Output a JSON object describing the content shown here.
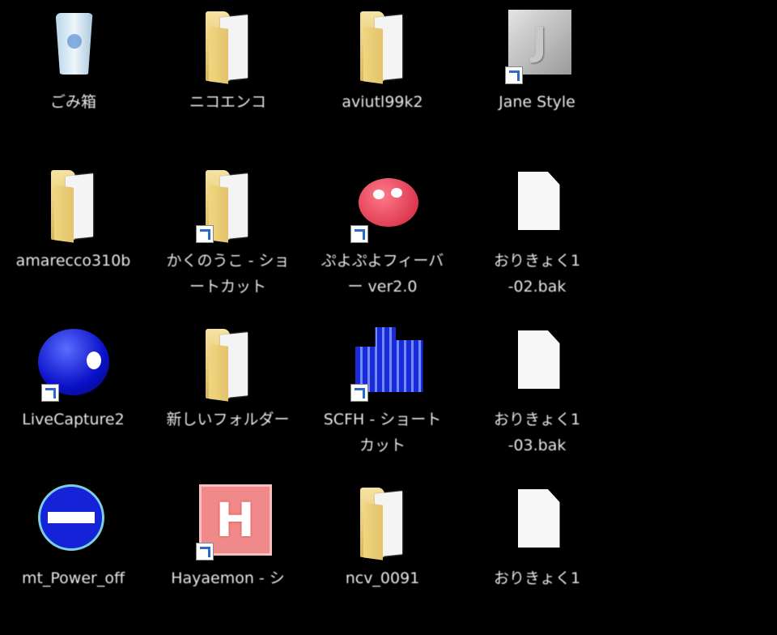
{
  "desktop": {
    "icons": [
      {
        "label": "ごみ箱",
        "icon": "recycle-bin-icon",
        "shortcut": false
      },
      {
        "label": "ニコエンコ",
        "icon": "folder-icon",
        "shortcut": false
      },
      {
        "label": "aviutl99k2",
        "icon": "folder-icon",
        "shortcut": false
      },
      {
        "label": "Jane Style",
        "icon": "jane-style-app-icon",
        "shortcut": true
      },
      {
        "label": "amarecco310b",
        "icon": "folder-icon",
        "shortcut": false
      },
      {
        "label": "かくのうこ - ショートカット",
        "icon": "folder-icon",
        "shortcut": true
      },
      {
        "label": "ぷよぷよフィーバー ver2.0",
        "icon": "puyo-app-icon",
        "shortcut": true
      },
      {
        "label": "おりきょく1-02.bak",
        "icon": "file-icon",
        "shortcut": false
      },
      {
        "label": "LiveCapture2",
        "icon": "livecapture-app-icon",
        "shortcut": true
      },
      {
        "label": "新しいフォルダー",
        "icon": "folder-icon",
        "shortcut": false
      },
      {
        "label": "SCFH - ショートカット",
        "icon": "scfh-app-icon",
        "shortcut": true
      },
      {
        "label": "おりきょく1-03.bak",
        "icon": "file-icon",
        "shortcut": false
      },
      {
        "label": "mt_Power_off",
        "icon": "no-entry-app-icon",
        "shortcut": false
      },
      {
        "label": "Hayaemon - シ",
        "icon": "hayaemon-app-icon",
        "shortcut": true
      },
      {
        "label": "ncv_0091",
        "icon": "folder-icon",
        "shortcut": false
      },
      {
        "label": "おりきょく1",
        "icon": "file-icon",
        "shortcut": false
      }
    ]
  }
}
